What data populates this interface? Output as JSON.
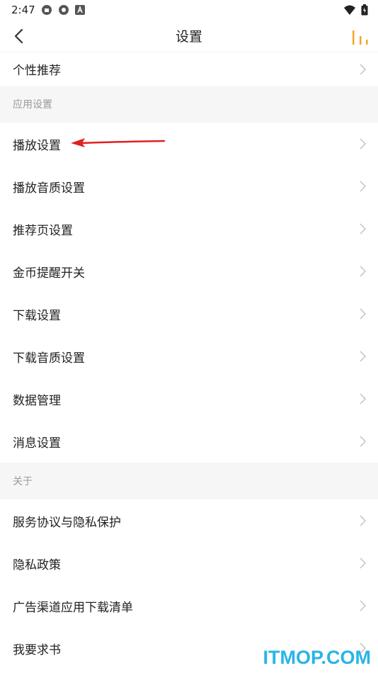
{
  "status_bar": {
    "time": "2:47"
  },
  "header": {
    "title": "设置"
  },
  "rows_top": [
    {
      "label": "个性推荐"
    }
  ],
  "sections": [
    {
      "title": "应用设置",
      "items": [
        {
          "label": "播放设置"
        },
        {
          "label": "播放音质设置"
        },
        {
          "label": "推荐页设置"
        },
        {
          "label": "金币提醒开关"
        },
        {
          "label": "下载设置"
        },
        {
          "label": "下载音质设置"
        },
        {
          "label": "数据管理"
        },
        {
          "label": "消息设置"
        }
      ]
    },
    {
      "title": "关于",
      "items": [
        {
          "label": "服务协议与隐私保护"
        },
        {
          "label": "隐私政策"
        },
        {
          "label": "广告渠道应用下载清单"
        },
        {
          "label": "我要求书"
        }
      ]
    }
  ],
  "watermark": "ITMOP.COM",
  "colors": {
    "accent": "#f5a623",
    "annotation_arrow": "#e02020",
    "watermark": "#28b4e8"
  },
  "icons": [
    "back-chevron-icon",
    "player-bars-icon",
    "chevron-right-icon",
    "wifi-icon",
    "battery-icon"
  ]
}
